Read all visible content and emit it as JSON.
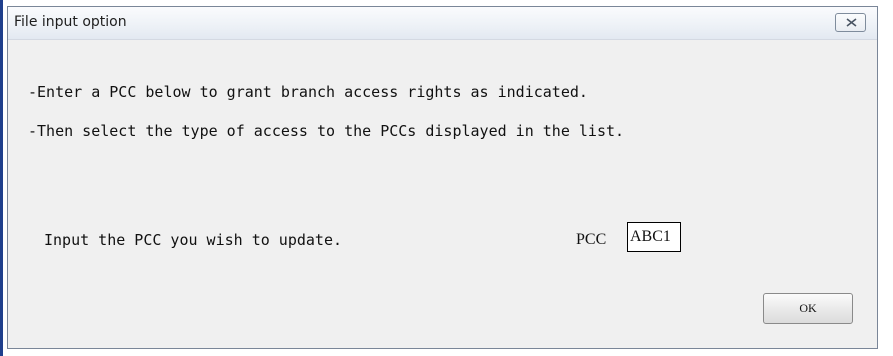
{
  "window": {
    "title": "File input option",
    "close_icon": "close-icon"
  },
  "instructions": {
    "line1": "-Enter a PCC below to grant branch access rights as indicated.",
    "line2": "-Then select the type of access to the PCCs displayed in the list."
  },
  "form": {
    "prompt": "Input the PCC you wish to update.",
    "pcc_label": "PCC",
    "pcc_value": "ABC1"
  },
  "buttons": {
    "ok_label": "OK"
  },
  "colors": {
    "accent_edge": "#1f3f8c",
    "dialog_background": "#f0f0f0",
    "titlebar_background": "#eef2f7"
  }
}
